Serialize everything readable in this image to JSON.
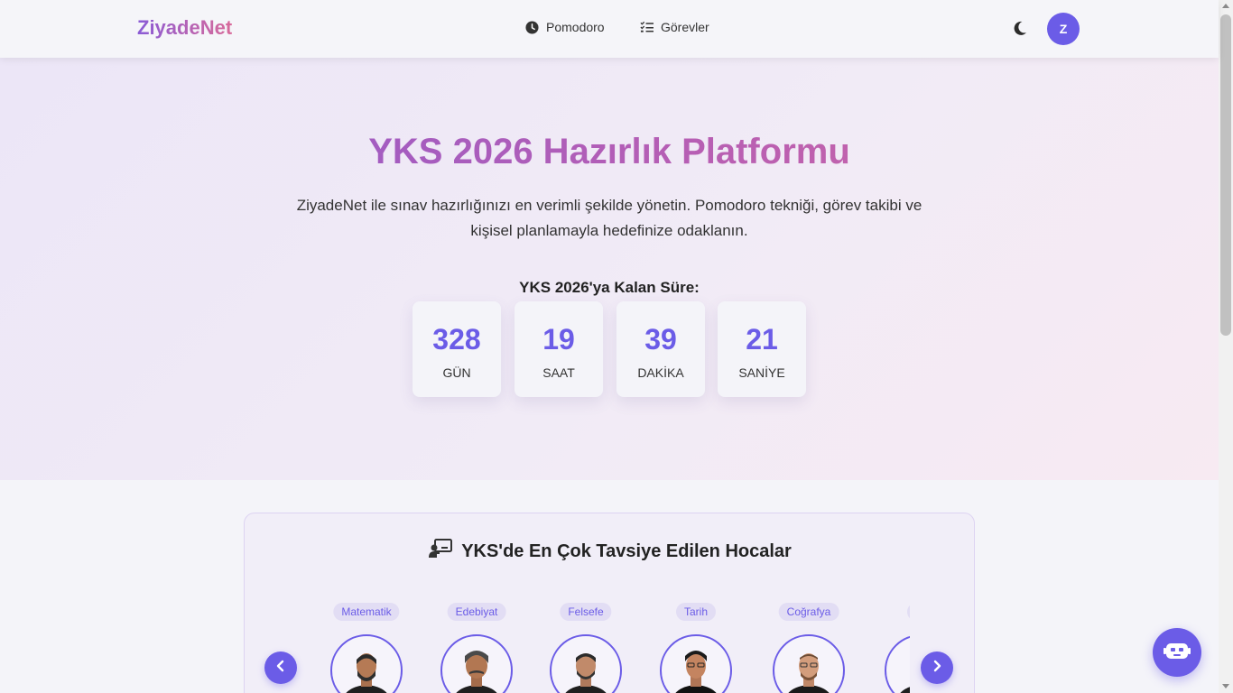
{
  "navbar": {
    "brand": "ZiyadeNet",
    "links": [
      {
        "label": "Pomodoro",
        "icon": "clock-icon"
      },
      {
        "label": "Görevler",
        "icon": "task-list-icon"
      }
    ],
    "theme_toggle_icon": "moon-icon",
    "avatar_letter": "Z"
  },
  "hero": {
    "title": "YKS 2026 Hazırlık Platformu",
    "subtitle": "ZiyadeNet ile sınav hazırlığınızı en verimli şekilde yönetin. Pomodoro tekniği, görev takibi ve kişisel planlamayla hedefinize odaklanın.",
    "countdown_label": "YKS 2026'ya Kalan Süre:",
    "countdown": [
      {
        "value": "328",
        "unit": "GÜN"
      },
      {
        "value": "19",
        "unit": "SAAT"
      },
      {
        "value": "39",
        "unit": "DAKİKA"
      },
      {
        "value": "21",
        "unit": "SANİYE"
      }
    ]
  },
  "teachers": {
    "title": "YKS'de En Çok Tavsiye Edilen Hocalar",
    "title_icon": "chalkboard-teacher-icon",
    "items": [
      {
        "subject": "Matematik"
      },
      {
        "subject": "Edebiyat"
      },
      {
        "subject": "Felsefe"
      },
      {
        "subject": "Tarih"
      },
      {
        "subject": "Coğrafya"
      },
      {
        "subject": ""
      }
    ],
    "prev_icon": "chevron-left-icon",
    "next_icon": "chevron-right-icon"
  },
  "chatbot_icon": "robot-icon",
  "colors": {
    "accent": "#6b5ce7",
    "brand_gradient_start": "#8a5bd6",
    "brand_gradient_end": "#d86a9a",
    "hero_bg": "#ece6f7"
  }
}
